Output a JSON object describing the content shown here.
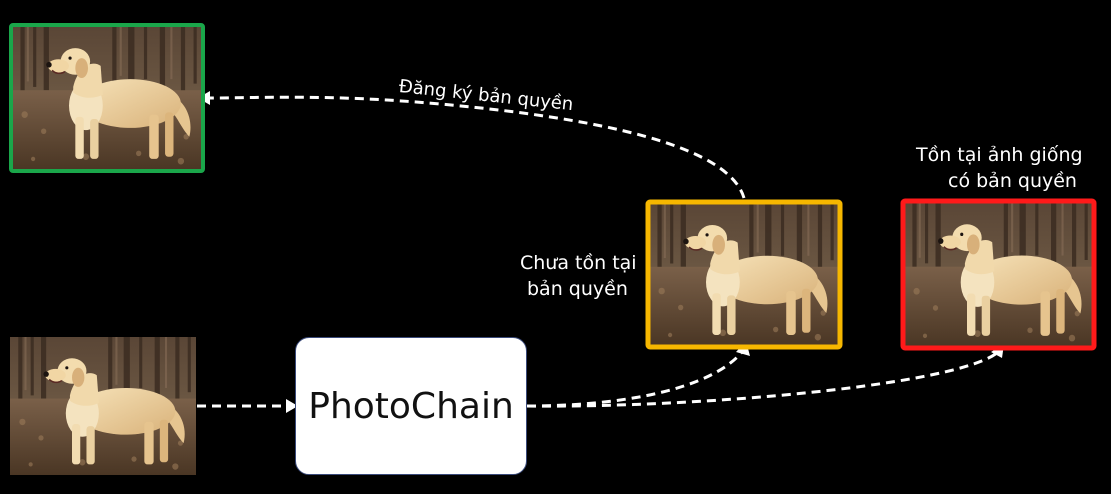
{
  "process_box": {
    "label": "PhotoChain"
  },
  "labels": {
    "register": "Đăng ký bản quyền",
    "not_exist_line1": "Chưa tồn tại",
    "not_exist_line2": "bản quyền",
    "exists_line1": "Tồn tại ảnh giống",
    "exists_line2": "có bản quyền"
  },
  "colors": {
    "background": "#000000",
    "registered_frame": "#1aa64a",
    "pending_frame": "#f6b700",
    "duplicate_frame": "#ff1a1a",
    "arrow": "#ffffff"
  },
  "images": {
    "input_photo": "golden-retriever-photo",
    "registered_photo": "golden-retriever-photo",
    "not_registered_photo": "golden-retriever-photo",
    "duplicate_photo": "golden-retriever-photo"
  }
}
